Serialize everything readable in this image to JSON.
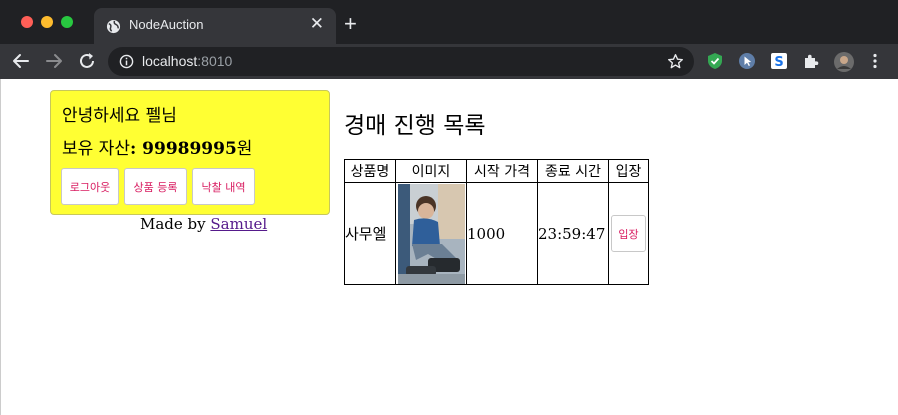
{
  "browser": {
    "tab_title": "NodeAuction",
    "new_tab_symbol": "+",
    "close_symbol": "✕",
    "url_host": "localhost",
    "url_port": ":8010"
  },
  "login": {
    "greeting": "안녕하세요 펠님",
    "asset_prefix": "보유 자산",
    "asset_value": ": 99989995",
    "asset_unit": "원",
    "logout_label": "로그아웃",
    "register_label": "상품 등록",
    "bids_label": "낙찰 내역"
  },
  "footer": {
    "made_by_prefix": "Made by ",
    "author": "Samuel"
  },
  "main": {
    "title": "경매 진행 목록",
    "columns": [
      "상품명",
      "이미지",
      "시작 가격",
      "종료 시간",
      "입장"
    ],
    "rows": [
      {
        "name": "사무엘",
        "image": "photo-of-child-on-exercise-machine",
        "start_price": "1000",
        "end_time": "23:59:47",
        "enter_label": "입장"
      }
    ]
  },
  "colors": {
    "card_bg": "#ffff33",
    "button_text": "#d81b60",
    "chrome_dark": "#202124",
    "chrome_tab": "#35363a"
  }
}
